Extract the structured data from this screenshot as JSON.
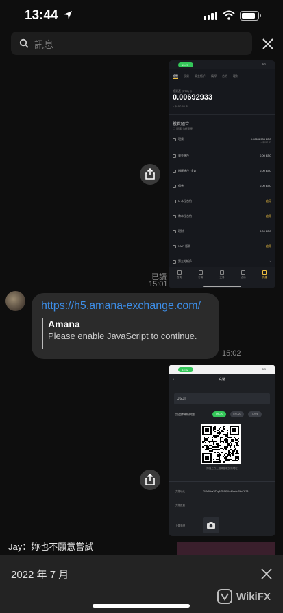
{
  "status_bar": {
    "time": "13:44"
  },
  "search": {
    "placeholder": "訊息"
  },
  "shot1": {
    "status_pill": "13:27",
    "network": "5G",
    "tabs": [
      "總覽",
      "現貨",
      "資金帳戶",
      "槓桿",
      "合約",
      "理財"
    ],
    "balance_label": "總資產 (BTC) ◎",
    "balance": "0.00692933",
    "balance_sub": "≈ $157.53 ⊕",
    "portfolio_title": "投資組合",
    "portfolio_sub": "◎ 隱藏小額資產",
    "rows": [
      {
        "name": "現貨",
        "value": "0.00692933 BTC",
        "sub": "≈ $157.53"
      },
      {
        "name": "資金帳戶",
        "value": "0.00 BTC"
      },
      {
        "name": "槓桿帳戶 (全倉)",
        "value": "0.00 BTC"
      },
      {
        "name": "債券",
        "value": "0.00 BTC"
      },
      {
        "name": "U 本位合約",
        "value": "啟用",
        "gold": true
      },
      {
        "name": "幣本位合約",
        "value": "啟用",
        "gold": true
      },
      {
        "name": "理財",
        "value": "0.00 BTC"
      },
      {
        "name": "NMR 賬測",
        "value": "啟用",
        "gold": true
      },
      {
        "name": "第三方帳戶",
        "value": ">"
      }
    ],
    "nav": [
      "首頁",
      "行情",
      "交易",
      "合約",
      "資產"
    ]
  },
  "message1": {
    "read": "已讀",
    "time": "15:01"
  },
  "message2": {
    "link": "https://h5.amana-exchange.com/",
    "preview_title": "Amana",
    "preview_text": "Please enable JavaScript to continue.",
    "time": "15:02"
  },
  "shot2": {
    "status_pill": "13:32",
    "network": "5G",
    "title": "充幣",
    "coin": "USDT",
    "network_label": "請選擇轉帳網路",
    "networks": [
      "TRC20",
      "ERC20",
      "Omni"
    ],
    "addr_note": "掃描上方二維碼獲取充幣地址",
    "addr_label": "充幣地址",
    "address": "TXACbtrV8Pnp1ZRC2jHc4Jus9nCLxPU78",
    "amount_label": "充幣數量",
    "upload_label": "上傳憑證"
  },
  "jay": {
    "text": "Jay：妳也不願意嘗試"
  },
  "bottom": {
    "date": "2022 年 7 月",
    "watermark": "WikiFX"
  }
}
